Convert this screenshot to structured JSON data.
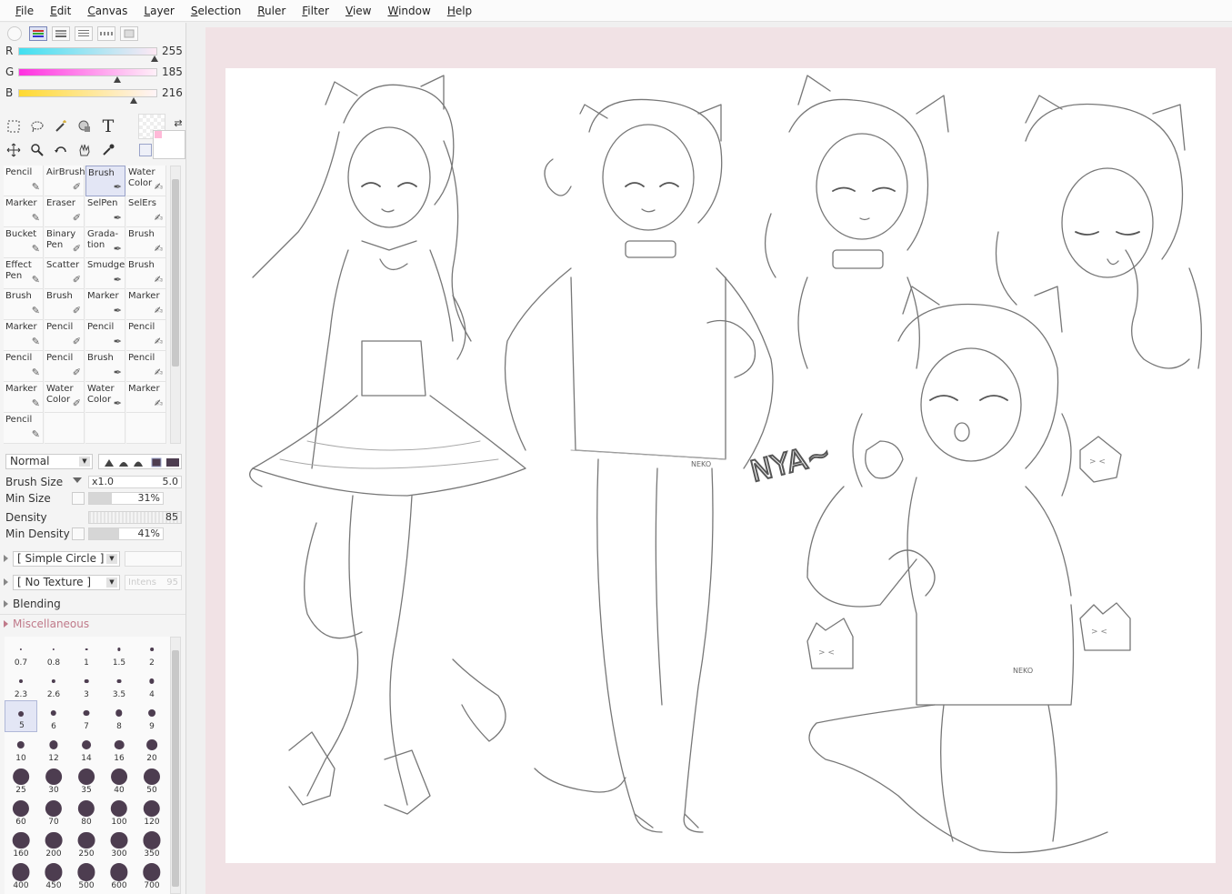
{
  "menu": [
    "File",
    "Edit",
    "Canvas",
    "Layer",
    "Selection",
    "Ruler",
    "Filter",
    "View",
    "Window",
    "Help"
  ],
  "color_sliders": [
    {
      "label": "R",
      "value": "255",
      "fraction": 1.0,
      "gradient": "linear-gradient(to right,#40e0f0,#ffe8f4)"
    },
    {
      "label": "G",
      "value": "185",
      "fraction": 0.725,
      "gradient": "linear-gradient(to right,#ff30e0,#fff0f8)"
    },
    {
      "label": "B",
      "value": "216",
      "fraction": 0.847,
      "gradient": "linear-gradient(to right,#ffd930,#fff4f8)"
    }
  ],
  "brushes": [
    {
      "name": "Pencil",
      "l2": ""
    },
    {
      "name": "AirBrush",
      "l2": ""
    },
    {
      "name": "Brush",
      "l2": ""
    },
    {
      "name": "Water",
      "l2": "Color"
    },
    {
      "name": "Marker",
      "l2": ""
    },
    {
      "name": "Eraser",
      "l2": ""
    },
    {
      "name": "SelPen",
      "l2": ""
    },
    {
      "name": "SelErs",
      "l2": ""
    },
    {
      "name": "Bucket",
      "l2": ""
    },
    {
      "name": "Binary",
      "l2": "Pen"
    },
    {
      "name": "Grada-",
      "l2": "tion"
    },
    {
      "name": "Brush",
      "l2": ""
    },
    {
      "name": "Effect",
      "l2": "Pen"
    },
    {
      "name": "Scatter",
      "l2": ""
    },
    {
      "name": "Smudge",
      "l2": ""
    },
    {
      "name": "Brush",
      "l2": ""
    },
    {
      "name": "Brush",
      "l2": ""
    },
    {
      "name": "Brush",
      "l2": ""
    },
    {
      "name": "Marker",
      "l2": ""
    },
    {
      "name": "Marker",
      "l2": ""
    },
    {
      "name": "Marker",
      "l2": ""
    },
    {
      "name": "Pencil",
      "l2": ""
    },
    {
      "name": "Pencil",
      "l2": ""
    },
    {
      "name": "Pencil",
      "l2": ""
    },
    {
      "name": "Pencil",
      "l2": ""
    },
    {
      "name": "Pencil",
      "l2": ""
    },
    {
      "name": "Brush",
      "l2": ""
    },
    {
      "name": "Pencil",
      "l2": ""
    },
    {
      "name": "Marker",
      "l2": ""
    },
    {
      "name": "Water",
      "l2": "Color"
    },
    {
      "name": "Water",
      "l2": "Color"
    },
    {
      "name": "Marker",
      "l2": ""
    },
    {
      "name": "Pencil",
      "l2": ""
    }
  ],
  "blend_mode": "Normal",
  "brush_size": {
    "label": "Brush Size",
    "mult": "x1.0",
    "value": "5.0"
  },
  "min_size": {
    "label": "Min Size",
    "value": "31%",
    "fraction": 0.31
  },
  "density": {
    "label": "Density",
    "value": "85",
    "fraction": 0.85
  },
  "min_density": {
    "label": "Min Density",
    "value": "41%",
    "fraction": 0.41
  },
  "shape": "[ Simple Circle ]",
  "texture": "[ No Texture ]",
  "texture_intensity": {
    "label": "Intens",
    "value": "95"
  },
  "sections": [
    "Blending",
    "Miscellaneous"
  ],
  "dot_sizes": [
    "0.7",
    "0.8",
    "1",
    "1.5",
    "2",
    "2.3",
    "2.6",
    "3",
    "3.5",
    "4",
    "5",
    "6",
    "7",
    "8",
    "9",
    "10",
    "12",
    "14",
    "16",
    "20",
    "25",
    "30",
    "35",
    "40",
    "50",
    "60",
    "70",
    "80",
    "100",
    "120",
    "160",
    "200",
    "250",
    "300",
    "350",
    "400",
    "450",
    "500",
    "600",
    "700"
  ],
  "selected_dot": "5",
  "canvas_text": {
    "nya": "NYA~",
    "tag1": "NEKO",
    "tag2": "NEKO",
    "snack1": "> <",
    "snack2": "> <",
    "snack3": "> <"
  },
  "colors": {
    "canvas_bg": "#f1e2e5",
    "dot": "#4d3d50",
    "selection": "#dfe4f5"
  }
}
